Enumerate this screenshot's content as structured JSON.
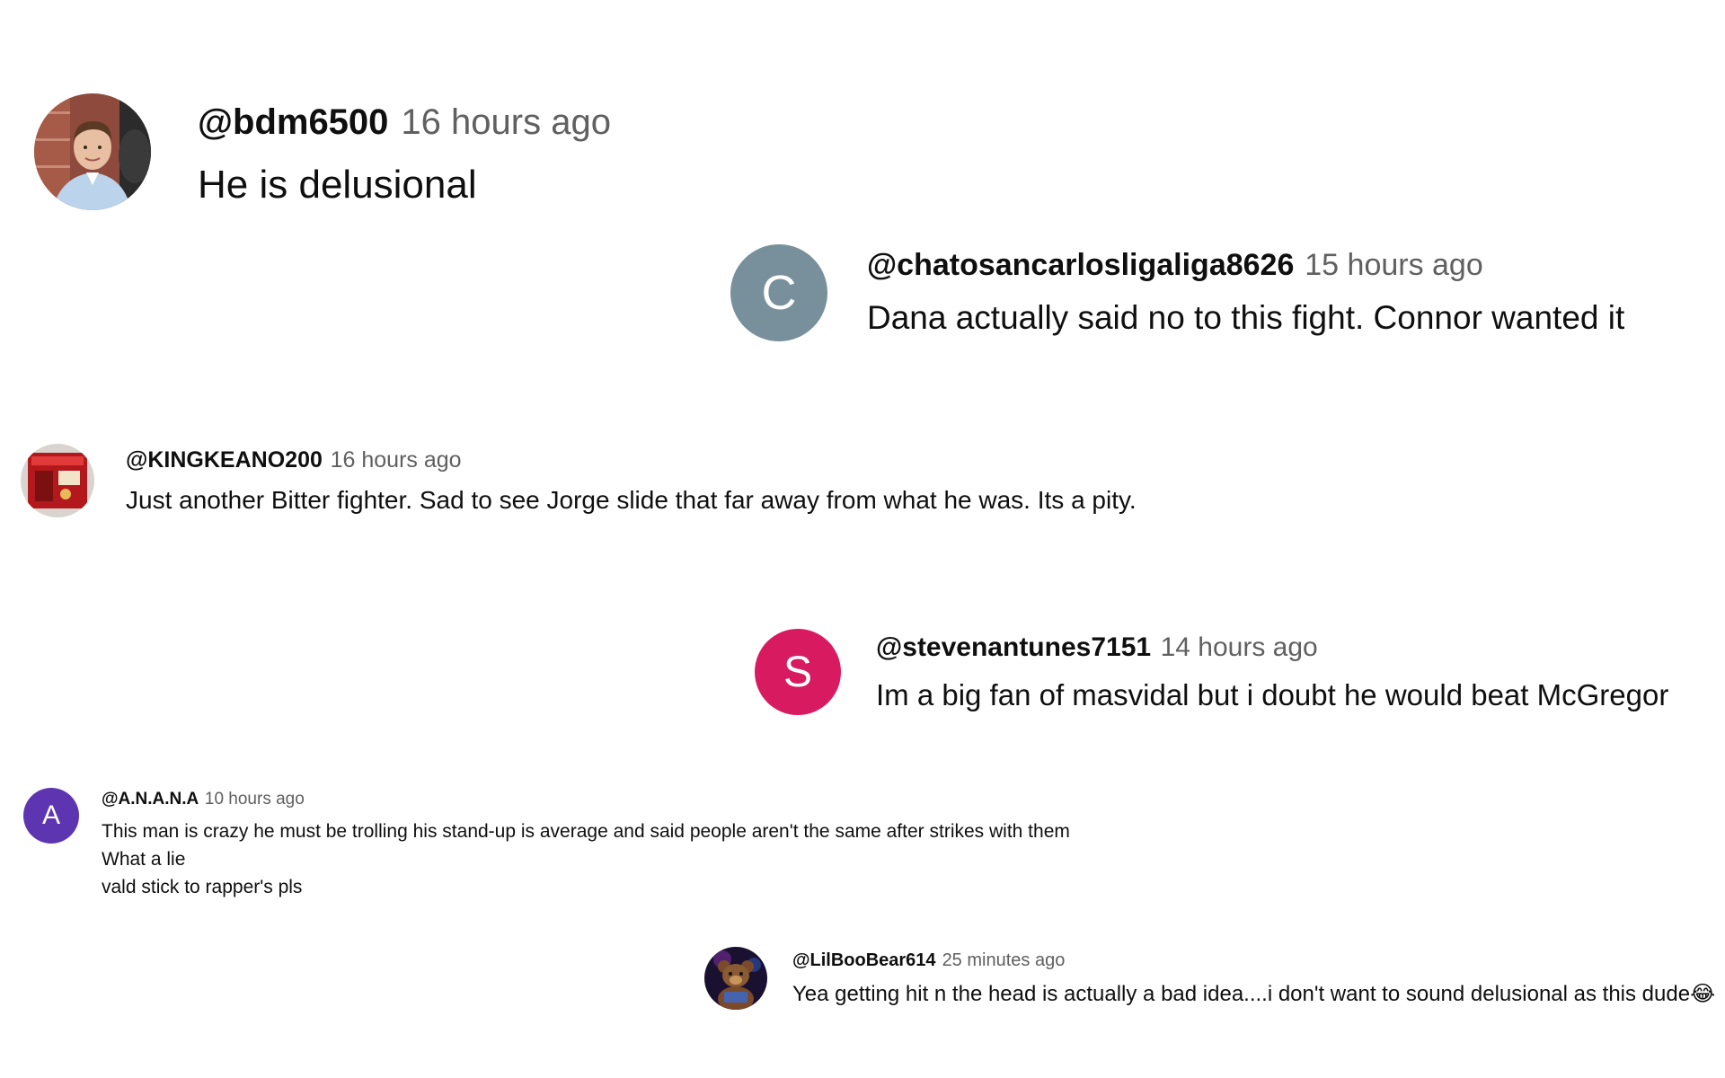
{
  "comments": [
    {
      "handle": "@bdm6500",
      "time": "16 hours ago",
      "text": "He is delusional",
      "avatar": {
        "type": "photo",
        "icon": "person-photo-avatar"
      }
    },
    {
      "handle": "@chatosancarlosligaliga8626",
      "time": "15 hours ago",
      "text": "Dana actually said no to this fight. Connor wanted it",
      "avatar": {
        "type": "letter",
        "letter": "C",
        "color": "#78909c"
      }
    },
    {
      "handle": "@KINGKEANO200",
      "time": "16 hours ago",
      "text": "Just another Bitter fighter. Sad to see Jorge slide that far away from what he was. Its a pity.",
      "avatar": {
        "type": "photo",
        "icon": "red-poster-avatar"
      }
    },
    {
      "handle": "@stevenantunes7151",
      "time": "14 hours ago",
      "text": "Im a big fan of masvidal but i doubt he would beat McGregor",
      "avatar": {
        "type": "letter",
        "letter": "S",
        "color": "#d81b60"
      }
    },
    {
      "handle": "@A.N.A.N.A",
      "time": "10 hours ago",
      "lines": [
        "This man is crazy he must be trolling  his stand-up is average and said people aren't the same after strikes with them",
        "What  a lie",
        "vald stick to  rapper's pls"
      ],
      "avatar": {
        "type": "letter",
        "letter": "A",
        "color": "#5e35b1"
      }
    },
    {
      "handle": "@LilBooBear614",
      "time": "25 minutes ago",
      "text": "Yea getting hit n the head is actually a bad idea....i don't want to sound delusional as this dude",
      "emoji": "😂",
      "avatar": {
        "type": "photo",
        "icon": "bear-avatar"
      }
    }
  ]
}
